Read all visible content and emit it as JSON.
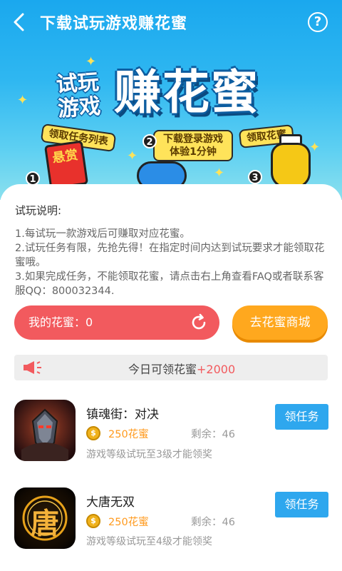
{
  "header": {
    "title": "下载试玩游戏赚花蜜",
    "help_icon": "?"
  },
  "hero": {
    "small_text": "试玩游戏",
    "main_text": "赚花蜜",
    "steps": [
      {
        "number": "1",
        "label": "领取任务列表",
        "prop_text": "悬赏"
      },
      {
        "number": "2",
        "label": "下载登录游戏体验1分钟"
      },
      {
        "number": "3",
        "label": "领取花蜜"
      }
    ]
  },
  "instructions": {
    "title": "试玩说明:",
    "lines": [
      "1.每试玩一款游戏后可赚取对应花蜜。",
      "2.试玩任务有限，先抢先得！在指定时间内达到试玩要求才能领取花蜜哦。",
      "3.如果完成任务，不能领取花蜜，请点击右上角查看FAQ或者联系客服QQ：800032344."
    ]
  },
  "actions": {
    "my_honey_label": "我的花蜜：0",
    "shop_label": "去花蜜商城"
  },
  "today": {
    "prefix": "今日可领花蜜",
    "amount": "+2000"
  },
  "games": [
    {
      "name": "镇魂街：对决",
      "reward": "250花蜜",
      "remaining": "剩余：46",
      "requirement": "游戏等级试玩至3级才能领奖",
      "button": "领任务"
    },
    {
      "name": "大唐无双",
      "icon_text": "唐",
      "reward": "250花蜜",
      "remaining": "剩余：46",
      "requirement": "游戏等级试玩至4级才能领奖",
      "button": "领任务"
    }
  ],
  "colors": {
    "header_blue": "#1aa8ee",
    "honey_red": "#f25a5e",
    "shop_orange": "#ffa81e",
    "task_blue": "#2ea7ee",
    "reward_orange": "#ff9a1e"
  }
}
